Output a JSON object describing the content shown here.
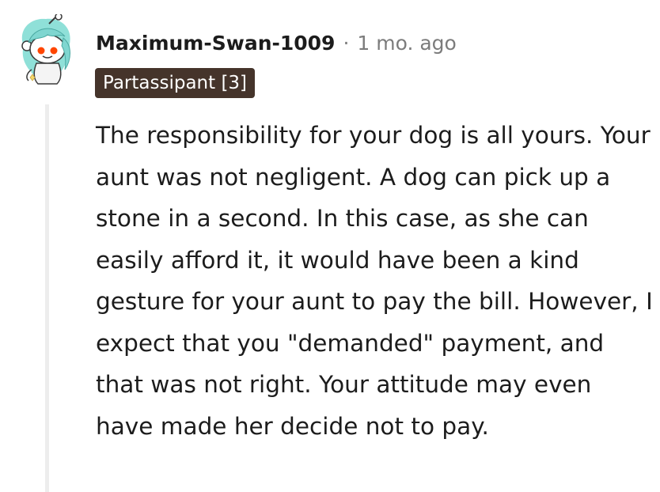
{
  "comment": {
    "author": "Maximum-Swan-1009",
    "separator": "·",
    "timestamp": "1 mo. ago",
    "flair": "Partassipant [3]",
    "avatar_icon": "snoo-avatar-icon",
    "body": "The responsibility for your dog is all yours. Your aunt was not negligent. A dog can pick up a stone in a second. In this case, as she can easily afford it, it would have been a kind gesture for your aunt to pay the bill. However, I expect that you \"demanded\" payment, and that was not right. Your attitude may even have made her decide not to pay."
  },
  "colors": {
    "flair_background": "#45342b",
    "flair_text": "#ffffff",
    "meta_text": "#7c7c7c",
    "thread_line": "#ededed",
    "avatar_hair": "#7fd6d0",
    "avatar_eye": "#ff4500"
  }
}
